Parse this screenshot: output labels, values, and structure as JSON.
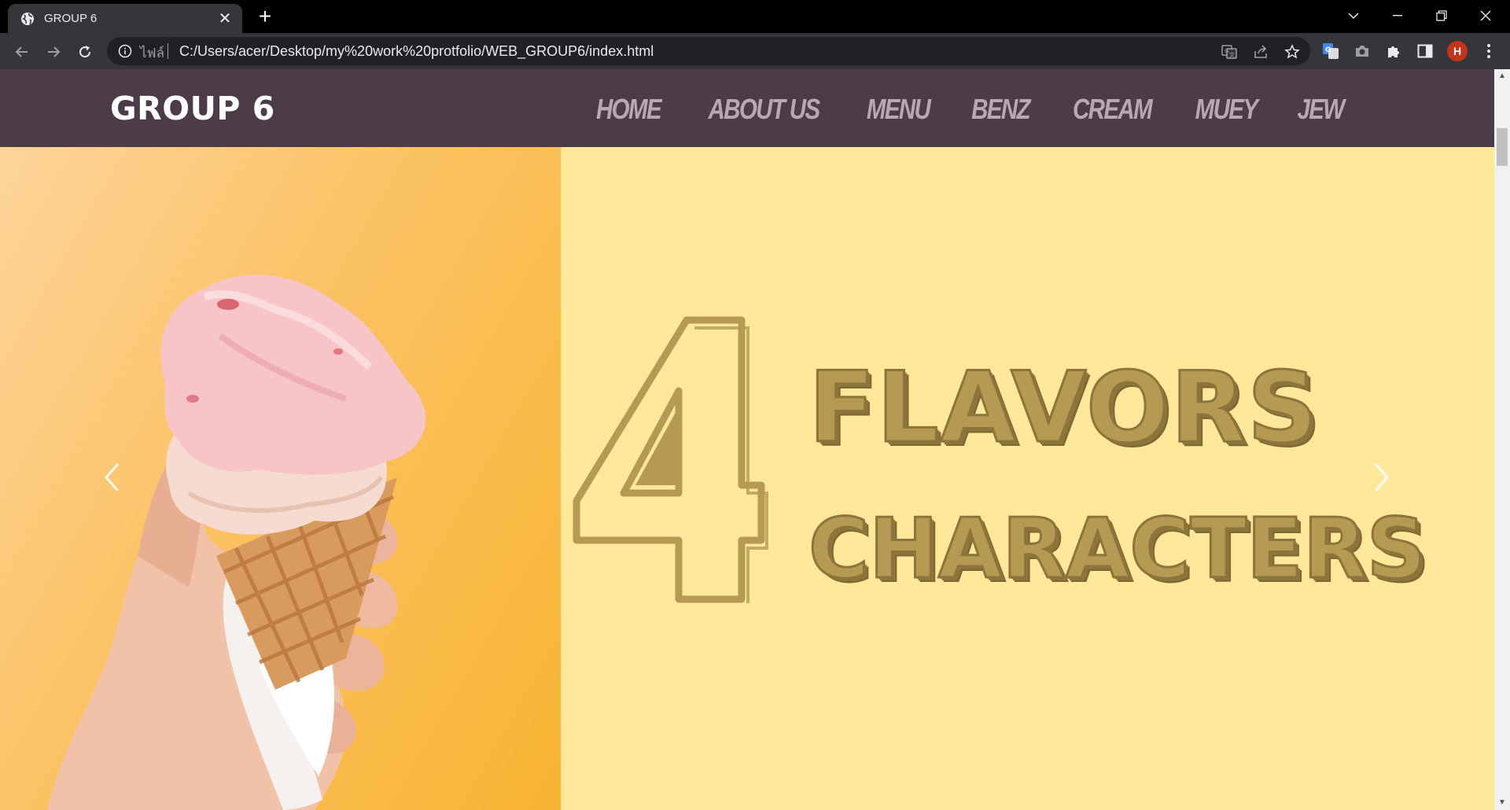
{
  "browser": {
    "tab_title": "GROUP 6",
    "close_glyph": "✕",
    "new_tab_glyph": "+",
    "url_scheme_label": "ไฟล์",
    "url": "C:/Users/acer/Desktop/my%20work%20protfolio/WEB_GROUP6/index.html",
    "profile_initial": "H",
    "icons": [
      "back-icon",
      "forward-icon",
      "reload-icon",
      "info-icon",
      "translate-icon",
      "share-icon",
      "star-icon",
      "google-translate-extension-icon",
      "camera-icon",
      "puzzle-icon",
      "side-panel-icon",
      "kebab-menu-icon",
      "tab-search-icon",
      "minimize-icon",
      "restore-icon",
      "window-close-icon"
    ]
  },
  "site": {
    "brand": "GROUP 6",
    "menu": [
      "HOME",
      "ABOUT US",
      "MENU",
      "BENZ",
      "CREAM",
      "MUEY",
      "JEW"
    ],
    "hero": {
      "big_number": "4",
      "line1": "FLAVORS",
      "line2": "CHARACTERS",
      "text_color": "#b49a52",
      "background_color": "#ffe899",
      "image": "hand-holding-strawberry-ice-cream-cone-photo"
    }
  },
  "colors": {
    "nav_bg": "#4c3c47",
    "nav_link": "#b9a8b1",
    "brand_text": "#ffffff"
  }
}
